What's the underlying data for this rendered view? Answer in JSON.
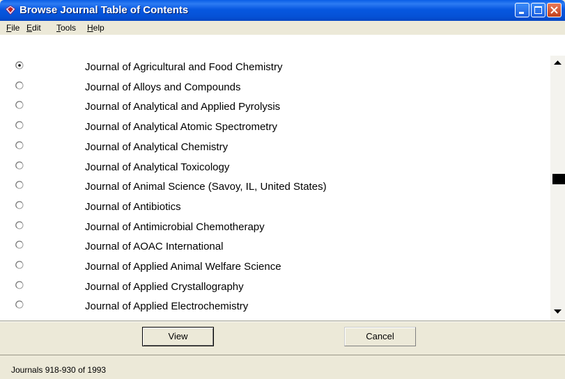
{
  "window": {
    "title": "Browse Journal Table of Contents",
    "icon": "diamond-app-icon"
  },
  "menu": {
    "items": [
      {
        "label": "File",
        "underline": "F",
        "rest": "ile"
      },
      {
        "label": "Edit",
        "underline": "E",
        "rest": "dit"
      },
      {
        "label": "Tools",
        "underline": "T",
        "rest": "ools"
      },
      {
        "label": "Help",
        "underline": "H",
        "rest": "elp"
      }
    ]
  },
  "journals": {
    "selected_index": 0,
    "items": [
      "Journal of Agricultural and Food Chemistry",
      "Journal of Alloys and Compounds",
      "Journal of Analytical and Applied Pyrolysis",
      "Journal of Analytical Atomic Spectrometry",
      "Journal of Analytical Chemistry",
      "Journal of Analytical Toxicology",
      "Journal of Animal Science (Savoy, IL, United States)",
      "Journal of Antibiotics",
      "Journal of Antimicrobial Chemotherapy",
      "Journal of AOAC International",
      "Journal of Applied Animal Welfare Science",
      "Journal of Applied Crystallography",
      "Journal of Applied Electrochemistry"
    ]
  },
  "buttons": {
    "view": "View",
    "cancel": "Cancel"
  },
  "status": {
    "text": "Journals 918-930 of 1993"
  }
}
